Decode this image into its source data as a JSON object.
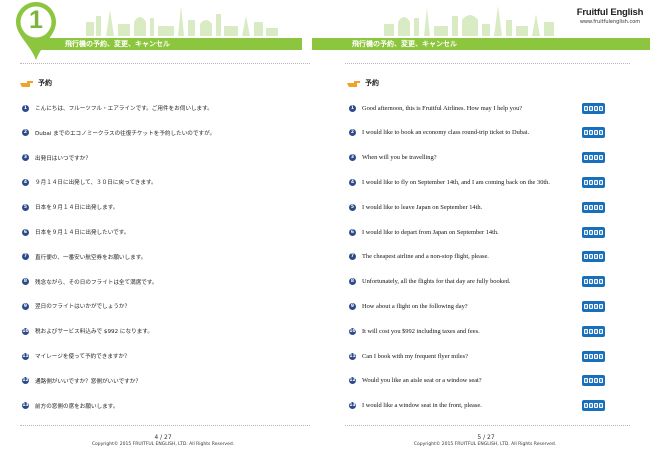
{
  "header": {
    "chapter_number": "1",
    "left_title": "飛行機の予約、変更、キャンセル",
    "right_title": "飛行機の予約、変更、キャンセル",
    "brand": "Fruitful English",
    "brand_url": "www.fruitfulenglish.com",
    "accent_color": "#8cc63e"
  },
  "left_page": {
    "section_label": "予約",
    "items": [
      {
        "num": "1",
        "text": "こんにちは、フルーツフル・エアラインです。ご用件をお伺いします。"
      },
      {
        "num": "2",
        "text": "Dubai までのエコノミークラスの往復チケットを予約したいのですが。"
      },
      {
        "num": "3",
        "text": "出発日はいつですか？"
      },
      {
        "num": "4",
        "text": "９月１４日に出発して、３０日に戻ってきます。"
      },
      {
        "num": "5",
        "text": "日本を９月１４日に出発します。"
      },
      {
        "num": "6",
        "text": "日本を９月１４日に出発したいです。"
      },
      {
        "num": "7",
        "text": "直行便の、一番安い航空券をお願いします。"
      },
      {
        "num": "8",
        "text": "残念ながら、その日のフライトは全て満席です。"
      },
      {
        "num": "9",
        "text": "翌日のフライトはいかがでしょうか？"
      },
      {
        "num": "10",
        "text": "税およびサービス料込みで $992 になります。"
      },
      {
        "num": "11",
        "text": "マイレージを使って予約できますか？"
      },
      {
        "num": "12",
        "text": "通路側がいいですか？窓側がいいですか？"
      },
      {
        "num": "13",
        "text": "前方の窓側の席をお願いします。"
      }
    ],
    "page_number": "4 / 27",
    "copyright": "Copyright© 2015 FRUITFUL ENGLISH, LTD. All Rights Reserved."
  },
  "right_page": {
    "section_label": "予約",
    "items": [
      {
        "num": "1",
        "text": "Good afternoon, this is Fruitful Airlines. How may I help you?"
      },
      {
        "num": "2",
        "text": "I would like to book an economy class round-trip ticket to Dubai."
      },
      {
        "num": "3",
        "text": "When will you be travelling?"
      },
      {
        "num": "4",
        "text": "I would like to fly on September 14th, and I am coming back on the 30th."
      },
      {
        "num": "5",
        "text": "I would like to leave Japan on September 14th."
      },
      {
        "num": "6",
        "text": "I would like to depart from Japan on September 14th."
      },
      {
        "num": "7",
        "text": "The cheapest airline and a non-stop flight, please."
      },
      {
        "num": "8",
        "text": "Unfortunately, all the flights for that day are fully booked."
      },
      {
        "num": "9",
        "text": "How about a flight on the following day?"
      },
      {
        "num": "10",
        "text": "It will cost you $992 including taxes and fees."
      },
      {
        "num": "11",
        "text": "Can I book with my frequent flyer miles?"
      },
      {
        "num": "12",
        "text": "Would you like an aisle seat or a window seat?"
      },
      {
        "num": "13",
        "text": "I would like a window seat in the front, please."
      }
    ],
    "audio_icon": "audio-controls-icon",
    "page_number": "5 / 27",
    "copyright": "Copyright© 2015 FRUITFUL ENGLISH, LTD. All Rights Reserved."
  }
}
